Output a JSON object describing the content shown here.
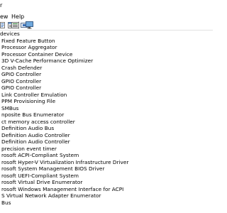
{
  "window": {
    "title": "r"
  },
  "menu": {
    "items": [
      "ew",
      "Help"
    ]
  },
  "toolbar": {
    "buttons": [
      "properties-icon",
      "list-icon",
      "update-driver-icon",
      "scan-hardware-icon",
      "monitor-icon"
    ]
  },
  "tree": {
    "root_label": "devices",
    "devices": [
      "Fixed Feature Button",
      "Processor Aggregator",
      "Processor Container Device",
      "3D V-Cache Performance Optimizer",
      "Crash Defender",
      "GPIO Controller",
      "GPIO Controller",
      "GPIO Controller",
      "Link Controller Emulation",
      "PPM Provisioning File",
      "SMBus",
      "nposite Bus Enumerator",
      "ct memory access controller",
      "Definition Audio Bus",
      "Definition Audio Controller",
      "Definition Audio Controller",
      "precision event timer",
      "rosoft ACPI-Compliant System",
      "rosoft Hyper-V Virtualization Infrastructure Driver",
      "rosoft System Management BIOS Driver",
      "rosoft UEFI-Compliant System",
      "rosoft Virtual Drive Enumerator",
      "rosoft Windows Management Interface for ACPI",
      "S Virtual Network Adapter Enumerator",
      "Bus"
    ]
  }
}
